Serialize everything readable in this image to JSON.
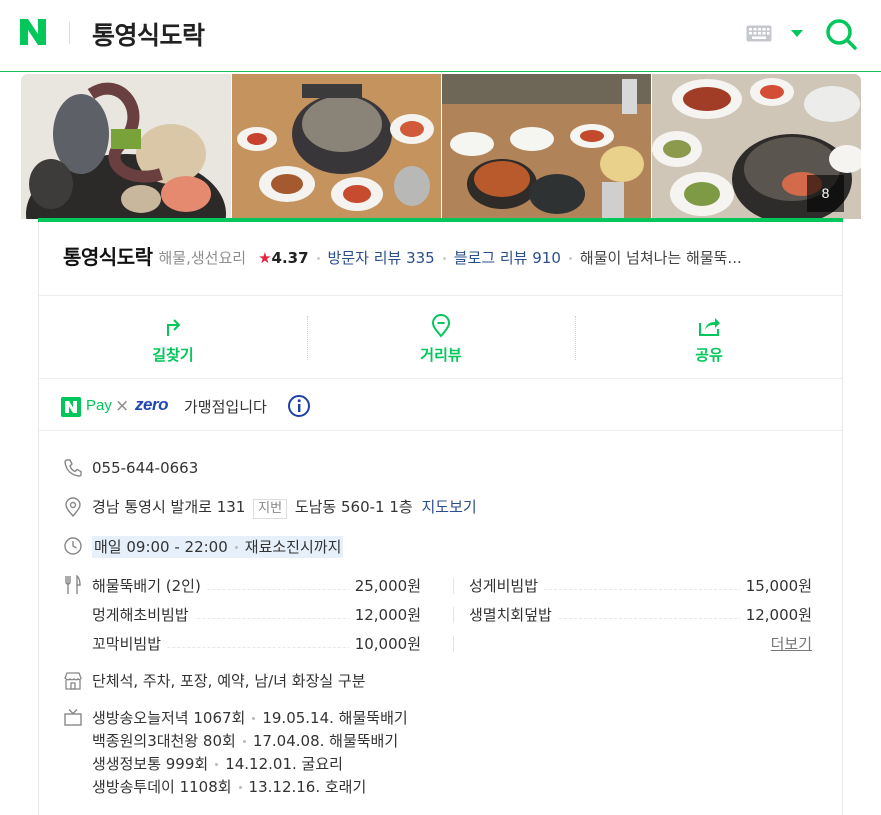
{
  "header": {
    "logo": "N",
    "title": "통영식도락",
    "icons": [
      "keyboard-icon",
      "caret-down-icon",
      "search-icon"
    ]
  },
  "photos": {
    "count": "8"
  },
  "summary": {
    "name": "통영식도락",
    "category": "해물,생선요리",
    "star": "★",
    "rating": "4.37",
    "visitor_review": "방문자 리뷰 335",
    "blog_review": "블로그 리뷰 910",
    "description": "해물이 넘쳐나는 해물뚝..."
  },
  "actions": [
    {
      "label": "길찾기",
      "icon": "directions-icon"
    },
    {
      "label": "거리뷰",
      "icon": "street-view-icon"
    },
    {
      "label": "공유",
      "icon": "share-icon"
    }
  ],
  "npay": {
    "pay": "Pay",
    "x": "×",
    "zero": "zero",
    "text": "가맹점입니다"
  },
  "info": {
    "phone": "055-644-0663",
    "address": "경남 통영시 발개로 131",
    "jibun_tag": "지번",
    "jibun": "도남동 560-1 1층",
    "map_link": "지도보기",
    "hours": "매일 09:00 - 22:00",
    "hours_note": "재료소진시까지",
    "facilities": "단체석, 주차, 포장, 예약, 남/녀 화장실 구분"
  },
  "menu": {
    "items": [
      {
        "name": "해물뚝배기 (2인)",
        "price": "25,000원"
      },
      {
        "name": "성게비빔밥",
        "price": "15,000원"
      },
      {
        "name": "멍게해초비빔밥",
        "price": "12,000원"
      },
      {
        "name": "생멸치회덮밥",
        "price": "12,000원"
      },
      {
        "name": "꼬막비빔밥",
        "price": "10,000원"
      }
    ],
    "more": "더보기"
  },
  "tv": [
    {
      "show": "생방송오늘저녁 1067회",
      "info": "19.05.14. 해물뚝배기"
    },
    {
      "show": "백종원의3대천왕 80회",
      "info": "17.04.08. 해물뚝배기"
    },
    {
      "show": "생생정보통 999회",
      "info": "14.12.01. 굴요리"
    },
    {
      "show": "생방송투데이 1108회",
      "info": "13.12.16. 호래기"
    }
  ],
  "colors": {
    "brand_green": "#03c75a",
    "link_blue": "#2b4e8c",
    "star_red": "#e4223c",
    "zero_blue": "#2346b5"
  }
}
